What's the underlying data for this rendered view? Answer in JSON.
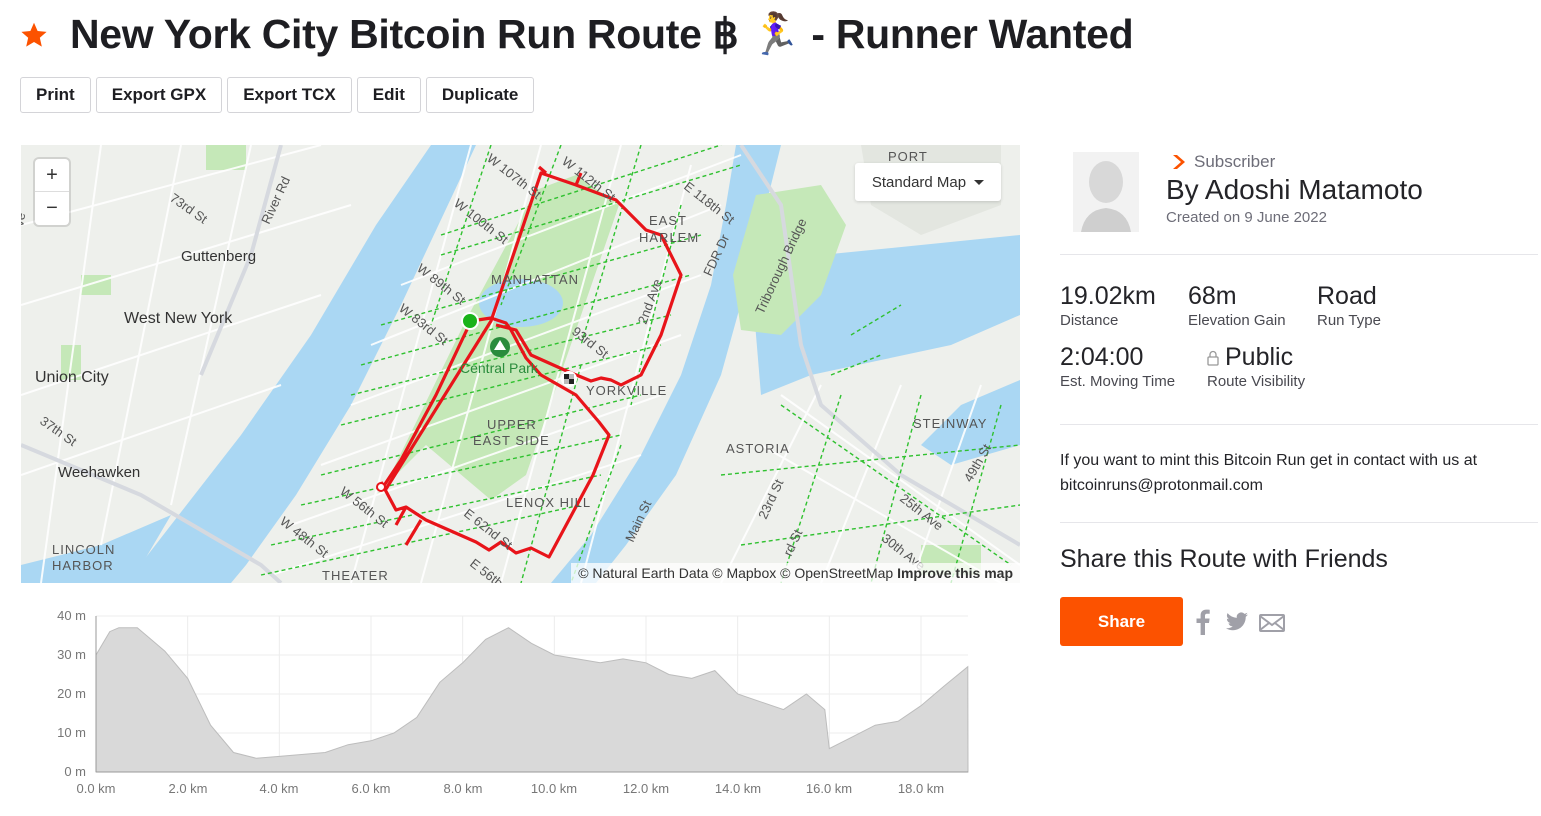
{
  "route": {
    "title": "New York City Bitcoin Run Route ฿ 🏃‍♀️ - Runner Wanted",
    "starred": true
  },
  "actions": [
    "Print",
    "Export GPX",
    "Export TCX",
    "Edit",
    "Duplicate"
  ],
  "map": {
    "style_selector": "Standard Map",
    "zoom_in": "+",
    "zoom_out": "−",
    "attribution": "© Natural Earth Data © Mapbox © OpenStreetMap",
    "improve_link": "Improve this map",
    "labels": {
      "w107": "W 107th St",
      "w112": "W 112th St",
      "e118": "E 118th St",
      "port": "PORT",
      "r73": "73rd St",
      "riverrd": "River Rd",
      "w100": "W 100th St",
      "eastharlem1": "EAST",
      "eastharlem2": "HARLEM",
      "guttenberg": "Guttenberg",
      "manhattan": "MANHATTAN",
      "w89": "W 89th St",
      "fdr": "FDR Dr",
      "triborough": "Triborough Bridge",
      "wny": "West New York",
      "w83": "W 83rd St",
      "secondave": "2nd Ave",
      "st93": "93rd St",
      "unioncity": "Union City",
      "centralpark": "Central Park",
      "yorkville": "YORKVILLE",
      "st37": "37th St",
      "ues1": "UPPER",
      "ues2": "EAST SIDE",
      "astoria": "ASTORIA",
      "steinway": "STEINWAY",
      "weehawken": "Weehawken",
      "lenoxhill": "LENOX HILL",
      "st49": "49th St",
      "ave25": "25th Ave",
      "w56": "W 56th St",
      "e62": "E 62nd St",
      "st23": "23rd St",
      "mainst": "Main St",
      "w48": "W 48th St",
      "ave30": "30th Ave",
      "lincoln1": "LINCOLN",
      "lincoln2": "HARBOR",
      "theater": "THEATER",
      "e56": "E 56th",
      "rd": "rd St",
      "ve": "ve"
    }
  },
  "elevation": {
    "y_ticks": [
      "40 m",
      "30 m",
      "20 m",
      "10 m",
      "0 m"
    ],
    "x_ticks": [
      "0.0 km",
      "2.0 km",
      "4.0 km",
      "6.0 km",
      "8.0 km",
      "10.0 km",
      "12.0 km",
      "14.0 km",
      "16.0 km",
      "18.0 km"
    ],
    "profile_km": [
      0,
      0.3,
      0.5,
      0.9,
      1.5,
      2.0,
      2.5,
      3.0,
      3.5,
      4.0,
      5.0,
      5.5,
      6.0,
      6.5,
      7.0,
      7.5,
      8.0,
      8.5,
      9.0,
      9.5,
      10.0,
      11.0,
      11.5,
      12.0,
      12.5,
      13.0,
      13.5,
      14.0,
      14.5,
      15.0,
      15.5,
      15.9,
      16.0,
      16.5,
      17.0,
      17.5,
      18.0,
      18.5,
      19.02
    ],
    "profile_m": [
      30,
      36,
      37,
      37,
      31,
      24,
      12,
      5,
      3.5,
      4,
      5,
      7,
      8,
      10,
      14,
      23,
      28,
      34,
      37,
      33,
      30,
      28,
      29,
      28,
      25,
      24,
      26,
      20,
      18,
      16,
      20,
      16,
      6,
      9,
      12,
      13,
      17,
      22,
      27
    ]
  },
  "author": {
    "badge": "Subscriber",
    "name": "By Adoshi Matamoto",
    "created": "Created on 9 June 2022"
  },
  "stats": {
    "distance": {
      "value": "19.02km",
      "label": "Distance"
    },
    "elevation_gain": {
      "value": "68m",
      "label": "Elevation Gain"
    },
    "run_type": {
      "value": "Road",
      "label": "Run Type"
    },
    "moving_time": {
      "value": "2:04:00",
      "label": "Est. Moving Time"
    },
    "visibility": {
      "value": "Public",
      "label": "Route Visibility"
    }
  },
  "description": "If you want to mint this Bitcoin Run get in contact with us at bitcoinruns@protonmail.com",
  "share": {
    "heading": "Share this Route with Friends",
    "button": "Share",
    "channels": [
      "facebook-icon",
      "twitter-icon",
      "email-icon"
    ]
  },
  "colors": {
    "accent": "#fc5200",
    "route": "#e8141a",
    "water": "#aad7f3",
    "park": "#c5e8b8",
    "bike_lane": "#2fc12f"
  }
}
